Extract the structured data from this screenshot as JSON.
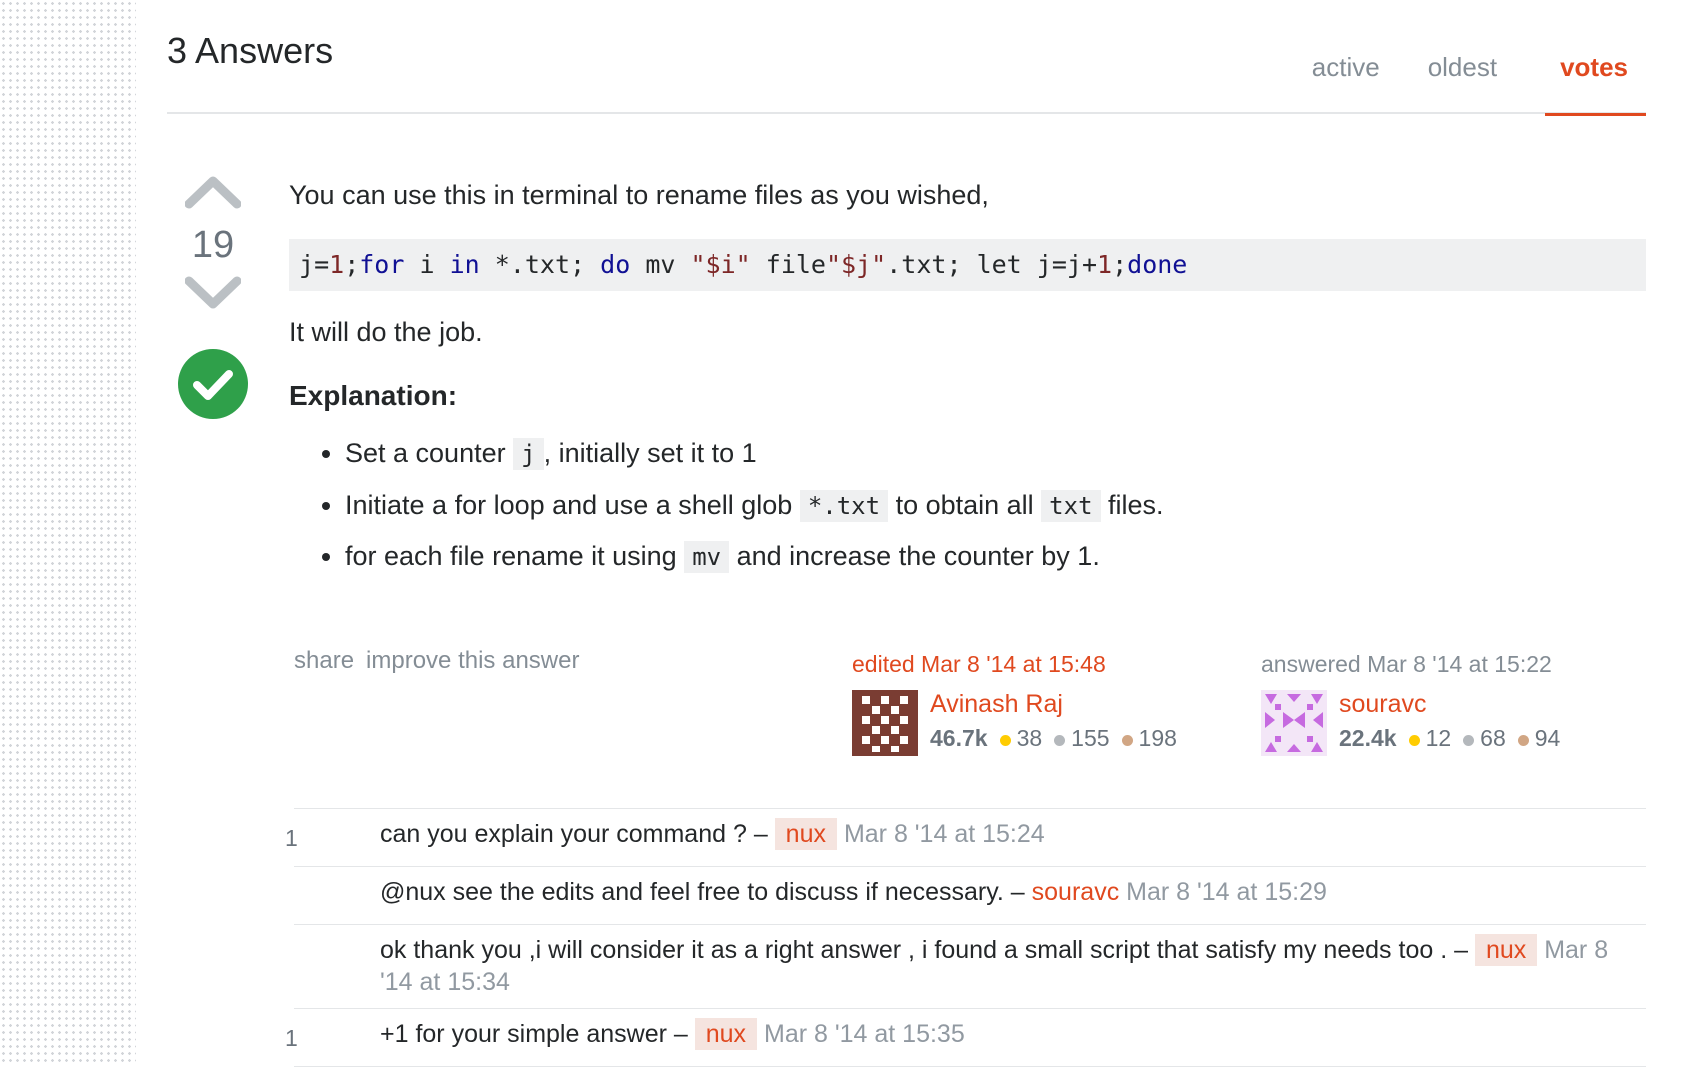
{
  "header": {
    "answers_count": "3 Answers",
    "tabs": [
      {
        "label": "active",
        "selected": false
      },
      {
        "label": "oldest",
        "selected": false
      },
      {
        "label": "votes",
        "selected": true
      }
    ]
  },
  "answer": {
    "vote_count": "19",
    "accepted": true,
    "intro": "You can use this in terminal to rename files as you wished,",
    "code": "j=1;for i in *.txt; do mv \"$i\" file\"$j\".txt; let j=j+1;done",
    "after_code": "It will do the job.",
    "explanation_heading": "Explanation:",
    "bullets": [
      {
        "before": "Set a counter ",
        "code": "j",
        "after": ", initially set it to 1"
      },
      {
        "before": "Initiate a for loop and use a shell glob ",
        "code": "*.txt",
        "middle": " to obtain all ",
        "code2": "txt",
        "after": " files."
      },
      {
        "before": "for each file rename it using ",
        "code": "mv",
        "after": " and increase the counter by 1."
      }
    ],
    "menu": {
      "share": "share",
      "improve": "improve this answer"
    },
    "edited": {
      "action": "edited Mar 8 '14 at 15:48",
      "user": "Avinash Raj",
      "rep": "46.7k",
      "gold": "38",
      "silver": "155",
      "bronze": "198"
    },
    "answered": {
      "action": "answered Mar 8 '14 at 15:22",
      "user": "souravc",
      "rep": "22.4k",
      "gold": "12",
      "silver": "68",
      "bronze": "94"
    }
  },
  "comments": [
    {
      "score": "1",
      "text": "can you explain your command ? – ",
      "user": "nux",
      "user_is_op": true,
      "date": "Mar 8 '14 at 15:24"
    },
    {
      "score": "",
      "text": "@nux see the edits and feel free to discuss if necessary. – ",
      "user": "souravc",
      "user_is_op": false,
      "date": "Mar 8 '14 at 15:29"
    },
    {
      "score": "",
      "text": "ok thank you ,i will consider it as a right answer , i found a small script that satisfy my needs too . – ",
      "user": "nux",
      "user_is_op": true,
      "date": "Mar 8 '14 at 15:34"
    },
    {
      "score": "1",
      "text": "+1 for your simple answer – ",
      "user": "nux",
      "user_is_op": true,
      "date": "Mar 8 '14 at 15:35"
    }
  ],
  "colors": {
    "accent": "#e0491f",
    "accepted_green": "#2fa04a",
    "muted": "#848d95",
    "code_bg": "#eff0f1"
  }
}
